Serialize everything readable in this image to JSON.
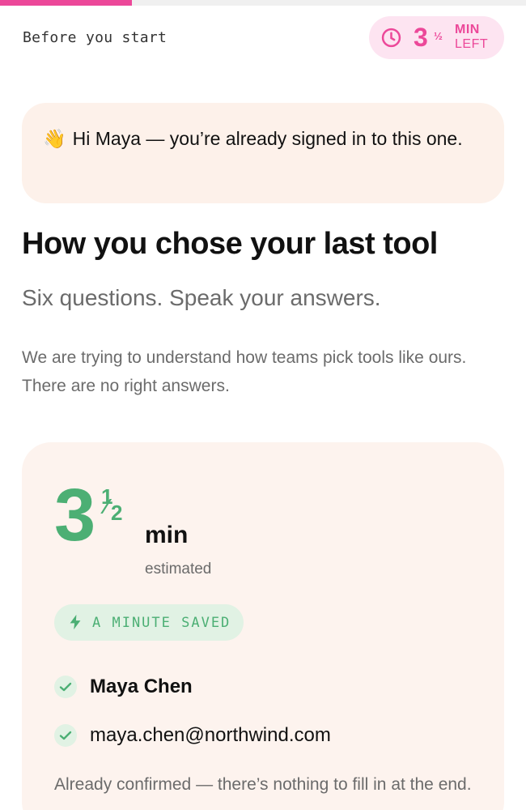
{
  "progress": {
    "fraction": 0.25
  },
  "header": {
    "eyebrow": "Before you start",
    "timer": {
      "whole": "3",
      "fraction": "½",
      "unit_top": "MIN",
      "unit_bottom": "LEFT",
      "icon": "clock-icon"
    }
  },
  "greeting": {
    "emoji": "👋",
    "text": "Hi Maya — you’re already signed in to this one."
  },
  "title": "How you chose your last tool",
  "subtitle": "Six questions. Speak your answers.",
  "intro": "We are trying to understand how teams pick tools like ours. There are no right answers.",
  "card": {
    "estimate_whole": "3",
    "estimate_num": "1",
    "estimate_den": "2",
    "estimate_unit": "min",
    "estimate_label": "estimated",
    "saved_badge": {
      "icon": "lightning-icon",
      "label": "A MINUTE SAVED"
    },
    "confirmed": [
      {
        "icon": "check-icon",
        "value": "Maya Chen"
      },
      {
        "icon": "check-icon",
        "value": "maya.chen@northwind.com"
      }
    ],
    "footnote": "Already confirmed — there’s nothing to fill in at the end."
  },
  "colors": {
    "accent_pink": "#ec4899",
    "accent_green": "#4caf74",
    "card_bg": "#fdf3ee"
  }
}
